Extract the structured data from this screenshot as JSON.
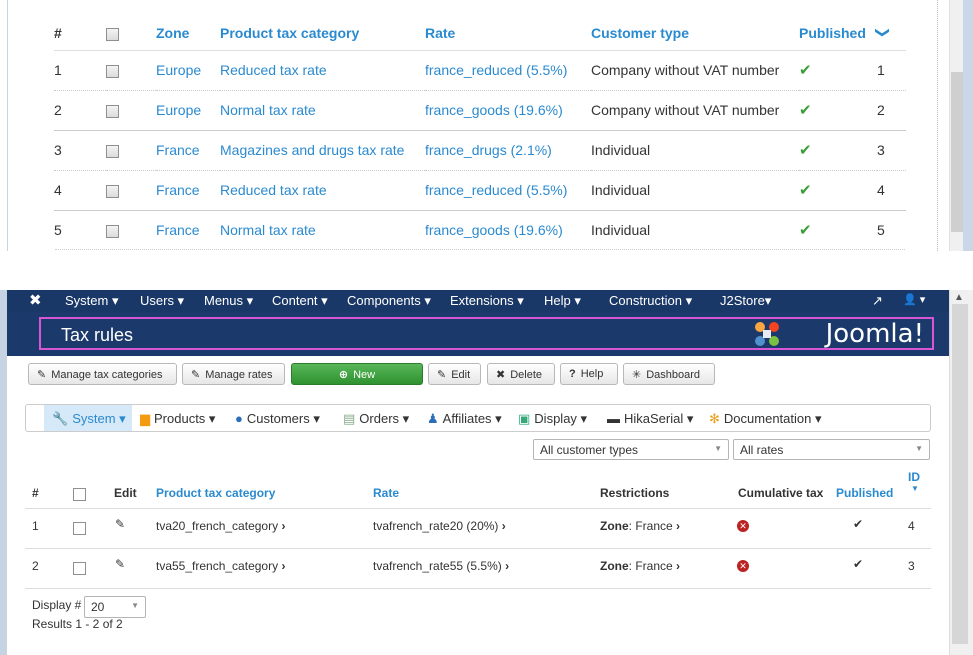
{
  "top_table": {
    "headers": {
      "num": "#",
      "zone": "Zone",
      "category": "Product tax category",
      "rate": "Rate",
      "customer_type": "Customer type",
      "published": "Published",
      "order": "❯"
    },
    "rows": [
      {
        "num": "1",
        "zone": "Europe",
        "category": "Reduced tax rate",
        "rate": "france_reduced (5.5%)",
        "customer_type": "Company without VAT number",
        "published": "✔",
        "order": "1"
      },
      {
        "num": "2",
        "zone": "Europe",
        "category": "Normal tax rate",
        "rate": "france_goods (19.6%)",
        "customer_type": "Company without VAT number",
        "published": "✔",
        "order": "2"
      },
      {
        "num": "3",
        "zone": "France",
        "category": "Magazines and drugs tax rate",
        "rate": "france_drugs (2.1%)",
        "customer_type": "Individual",
        "published": "✔",
        "order": "3"
      },
      {
        "num": "4",
        "zone": "France",
        "category": "Reduced tax rate",
        "rate": "france_reduced (5.5%)",
        "customer_type": "Individual",
        "published": "✔",
        "order": "4"
      },
      {
        "num": "5",
        "zone": "France",
        "category": "Normal tax rate",
        "rate": "france_goods (19.6%)",
        "customer_type": "Individual",
        "published": "✔",
        "order": "5"
      }
    ]
  },
  "navbar": {
    "logo": "✖",
    "items": [
      "System ▾",
      "Users ▾",
      "Menus ▾",
      "Content ▾",
      "Components ▾",
      "Extensions ▾",
      "Help ▾",
      "Construction ▾",
      "J2Store▾"
    ],
    "right_icons": [
      "↗",
      "👤 ▾"
    ]
  },
  "header": {
    "title": "Tax rules",
    "brand": "Joomla!"
  },
  "toolbar": {
    "manage_categories": "Manage tax categories",
    "manage_rates": "Manage rates",
    "new": "New",
    "edit": "Edit",
    "delete": "Delete",
    "help": "Help",
    "dashboard": "Dashboard"
  },
  "menu": {
    "items": [
      "System ▾",
      "Products ▾",
      "Customers ▾",
      "Orders ▾",
      "Affiliates ▾",
      "Display ▾",
      "HikaSerial ▾",
      "Documentation ▾"
    ]
  },
  "filters": {
    "customer_types": "All customer types",
    "rates": "All rates"
  },
  "bottom_table": {
    "headers": {
      "num": "#",
      "edit": "Edit",
      "category": "Product tax category",
      "rate": "Rate",
      "restrictions": "Restrictions",
      "cumulative": "Cumulative tax",
      "published": "Published",
      "id": "ID"
    },
    "rows": [
      {
        "num": "1",
        "category": "tva20_french_category",
        "rate": "tvafrench_rate20 (20%)",
        "zone_label": "Zone",
        "zone_value": ": France",
        "id": "4"
      },
      {
        "num": "2",
        "category": "tva55_french_category",
        "rate": "tvafrench_rate55 (5.5%)",
        "zone_label": "Zone",
        "zone_value": ": France",
        "id": "3"
      }
    ]
  },
  "footer": {
    "display_label": "Display #",
    "display_value": "20",
    "results": "Results 1 - 2 of 2"
  }
}
